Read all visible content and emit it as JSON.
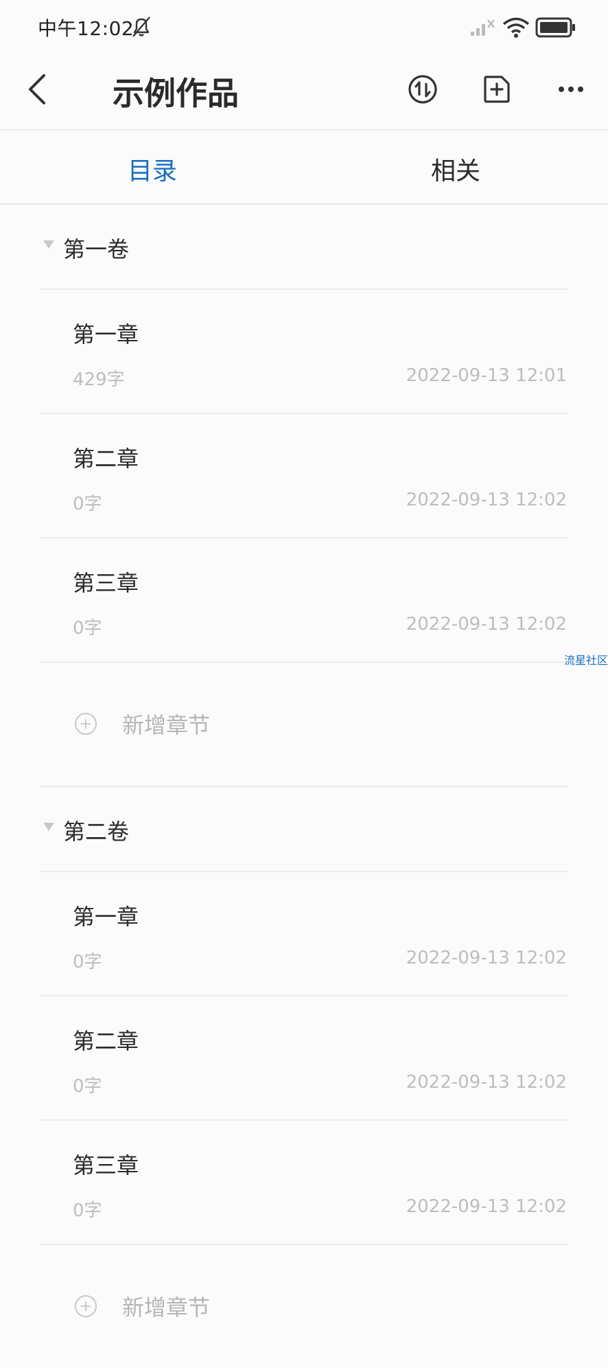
{
  "status_bar": {
    "time": "中午12:02"
  },
  "header": {
    "title": "示例作品"
  },
  "tabs": [
    {
      "label": "目录",
      "active": true
    },
    {
      "label": "相关",
      "active": false
    }
  ],
  "colors": {
    "accent": "#1a6fc2",
    "muted": "#bdbdbd"
  },
  "volumes": [
    {
      "title": "第一卷",
      "chapters": [
        {
          "title": "第一章",
          "words": "429字",
          "date": "2022-09-13 12:01"
        },
        {
          "title": "第二章",
          "words": "0字",
          "date": "2022-09-13 12:02"
        },
        {
          "title": "第三章",
          "words": "0字",
          "date": "2022-09-13 12:02"
        }
      ],
      "add_label": "新增章节"
    },
    {
      "title": "第二卷",
      "chapters": [
        {
          "title": "第一章",
          "words": "0字",
          "date": "2022-09-13 12:02"
        },
        {
          "title": "第二章",
          "words": "0字",
          "date": "2022-09-13 12:02"
        },
        {
          "title": "第三章",
          "words": "0字",
          "date": "2022-09-13 12:02"
        }
      ],
      "add_label": "新增章节"
    }
  ],
  "watermark": "流星社区"
}
